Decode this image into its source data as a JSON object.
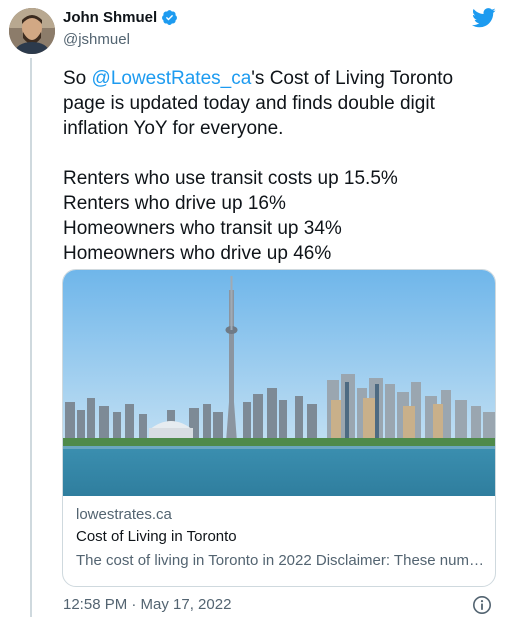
{
  "author": {
    "display_name": "John Shmuel",
    "handle": "@jshmuel",
    "verified": true
  },
  "icons": {
    "verified": "verified-badge-icon",
    "brand": "twitter-bird-icon",
    "info": "info-icon"
  },
  "tweet": {
    "text_prefix": "So ",
    "mention": "@LowestRates_ca",
    "text_suffix": "'s Cost of Living Toronto page is updated today and finds double digit inflation YoY for everyone.",
    "stats": [
      "Renters who use transit costs up 15.5%",
      "Renters who drive up 16%",
      "Homeowners who transit up 34%",
      "Homeowners who drive up 46%"
    ]
  },
  "card": {
    "domain": "lowestrates.ca",
    "title": "Cost of Living in Toronto",
    "description": "The cost of living in Toronto in 2022 Disclaimer: These num…"
  },
  "timestamp": "12:58 PM · May 17, 2022",
  "colors": {
    "link": "#1d9bf0",
    "secondary_text": "#536471",
    "primary_text": "#0f1419",
    "border": "#cfd9de"
  }
}
